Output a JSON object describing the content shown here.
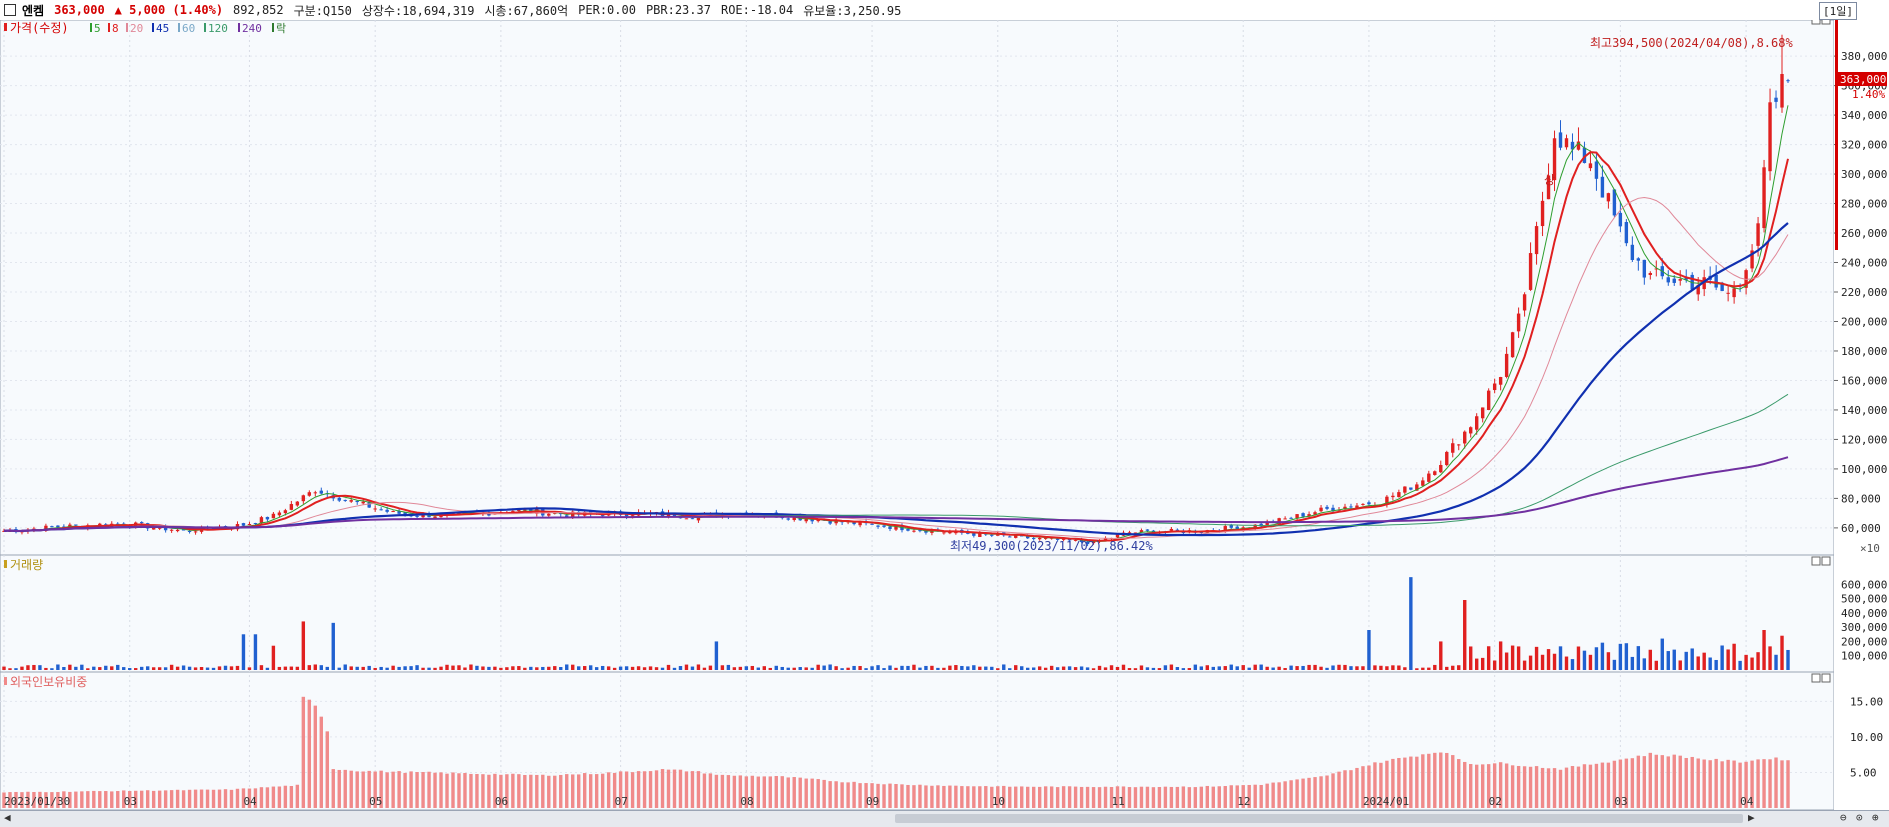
{
  "header": {
    "stock_name": "엔켐",
    "price": "363,000",
    "change": "▲ 5,000 (1.40%)",
    "volume": "892,852",
    "segment": "구분:Q150",
    "listed_shares": "상장수:18,694,319",
    "market_cap": "시총:67,860억",
    "per": "PER:0.00",
    "pbr": "PBR:23.37",
    "roe": "ROE:-18.04",
    "float": "유보율:3,250.95",
    "period": "[1일]"
  },
  "legend": {
    "price_label": "가격(수정)",
    "ma": [
      {
        "label": "5",
        "color": "#2e9e2e"
      },
      {
        "label": "8",
        "color": "#e02020"
      },
      {
        "label": "20",
        "color": "#e08898"
      },
      {
        "label": "45",
        "color": "#1030b0"
      },
      {
        "label": "60",
        "color": "#7aa8c8"
      },
      {
        "label": "120",
        "color": "#3a9a6a"
      },
      {
        "label": "240",
        "color": "#7030a0"
      },
      {
        "label": "락",
        "color": "#2e7a2e"
      }
    ],
    "volume_label": "거래량",
    "foreign_label": "외국인보유비중"
  },
  "annotations": {
    "high": "최고394,500(2024/04/08),8.68%",
    "low": "최저49,300(2023/11/02),86.42%",
    "current_price_tag": "363,000",
    "current_pct_tag": "1.40%",
    "volume_unit": "×10",
    "mark_sang": "상"
  },
  "colors": {
    "up": "#e02020",
    "down": "#2060d0",
    "volume_up": "#e02020",
    "volume_down": "#2060d0",
    "foreign": "#f08a8a"
  },
  "chart_data": {
    "type": "candlestick",
    "x_tick_labels": [
      "2023/01/30",
      "03",
      "04",
      "05",
      "06",
      "07",
      "08",
      "09",
      "10",
      "11",
      "12",
      "2024/01",
      "02",
      "03",
      "04"
    ],
    "price_axis": {
      "min": 45000,
      "max": 395000,
      "ticks": [
        60000,
        80000,
        100000,
        120000,
        140000,
        160000,
        180000,
        200000,
        220000,
        240000,
        260000,
        280000,
        300000,
        320000,
        340000,
        360000,
        380000
      ]
    },
    "price_anchors": [
      [
        0,
        58000
      ],
      [
        10,
        61000
      ],
      [
        20,
        63000
      ],
      [
        30,
        58000
      ],
      [
        40,
        62000
      ],
      [
        45,
        68000
      ],
      [
        52,
        86000
      ],
      [
        58,
        78000
      ],
      [
        65,
        70000
      ],
      [
        75,
        68000
      ],
      [
        85,
        72000
      ],
      [
        95,
        69000
      ],
      [
        105,
        70000
      ],
      [
        115,
        68000
      ],
      [
        125,
        70000
      ],
      [
        135,
        66000
      ],
      [
        145,
        62000
      ],
      [
        155,
        58000
      ],
      [
        165,
        55000
      ],
      [
        175,
        52000
      ],
      [
        182,
        50000
      ],
      [
        188,
        57000
      ],
      [
        200,
        58000
      ],
      [
        210,
        62000
      ],
      [
        220,
        72000
      ],
      [
        230,
        78000
      ],
      [
        236,
        90000
      ],
      [
        240,
        105000
      ],
      [
        245,
        130000
      ],
      [
        250,
        165000
      ],
      [
        253,
        200000
      ],
      [
        256,
        260000
      ],
      [
        259,
        330000
      ],
      [
        262,
        315000
      ],
      [
        265,
        310000
      ],
      [
        268,
        280000
      ],
      [
        271,
        250000
      ],
      [
        275,
        230000
      ],
      [
        280,
        228000
      ],
      [
        285,
        225000
      ],
      [
        288,
        218000
      ],
      [
        290,
        230000
      ],
      [
        293,
        260000
      ],
      [
        295,
        340000
      ],
      [
        297,
        360000
      ],
      [
        298,
        363000
      ]
    ],
    "volume_axis": {
      "ticks": [
        100000,
        200000,
        300000,
        400000,
        500000,
        600000
      ],
      "unit": "×10"
    },
    "volume_spikes": [
      [
        40,
        250000
      ],
      [
        42,
        250000
      ],
      [
        45,
        170000
      ],
      [
        50,
        340000
      ],
      [
        55,
        330000
      ],
      [
        119,
        200000
      ],
      [
        228,
        280000
      ],
      [
        235,
        650000
      ],
      [
        240,
        200000
      ],
      [
        244,
        490000
      ],
      [
        250,
        200000
      ],
      [
        277,
        220000
      ],
      [
        294,
        280000
      ],
      [
        297,
        240000
      ]
    ],
    "volume_base": 30000,
    "foreign_axis": {
      "ticks": [
        5.0,
        10.0,
        15.0
      ]
    },
    "foreign_anchors": [
      [
        0,
        2.2
      ],
      [
        38,
        2.6
      ],
      [
        49,
        3.2
      ],
      [
        50,
        15.3
      ],
      [
        51,
        15.0
      ],
      [
        52,
        14.2
      ],
      [
        53,
        13.0
      ],
      [
        54,
        11.0
      ],
      [
        55,
        5.5
      ],
      [
        60,
        5.2
      ],
      [
        70,
        5.0
      ],
      [
        80,
        4.8
      ],
      [
        90,
        4.6
      ],
      [
        100,
        4.9
      ],
      [
        110,
        5.4
      ],
      [
        115,
        5.2
      ],
      [
        120,
        4.6
      ],
      [
        130,
        4.4
      ],
      [
        140,
        3.7
      ],
      [
        150,
        3.3
      ],
      [
        160,
        3.1
      ],
      [
        170,
        3.0
      ],
      [
        180,
        3.0
      ],
      [
        190,
        3.0
      ],
      [
        200,
        3.0
      ],
      [
        210,
        3.3
      ],
      [
        220,
        4.4
      ],
      [
        230,
        6.5
      ],
      [
        240,
        8.0
      ],
      [
        245,
        6.2
      ],
      [
        250,
        6.3
      ],
      [
        260,
        5.5
      ],
      [
        270,
        6.8
      ],
      [
        275,
        7.6
      ],
      [
        280,
        7.3
      ],
      [
        285,
        6.8
      ],
      [
        290,
        6.5
      ],
      [
        295,
        7.0
      ],
      [
        298,
        6.8
      ]
    ],
    "high": {
      "value": 394500,
      "date": "2024/04/08"
    },
    "low": {
      "value": 49300,
      "date": "2023/11/02"
    },
    "n_days": 299
  }
}
